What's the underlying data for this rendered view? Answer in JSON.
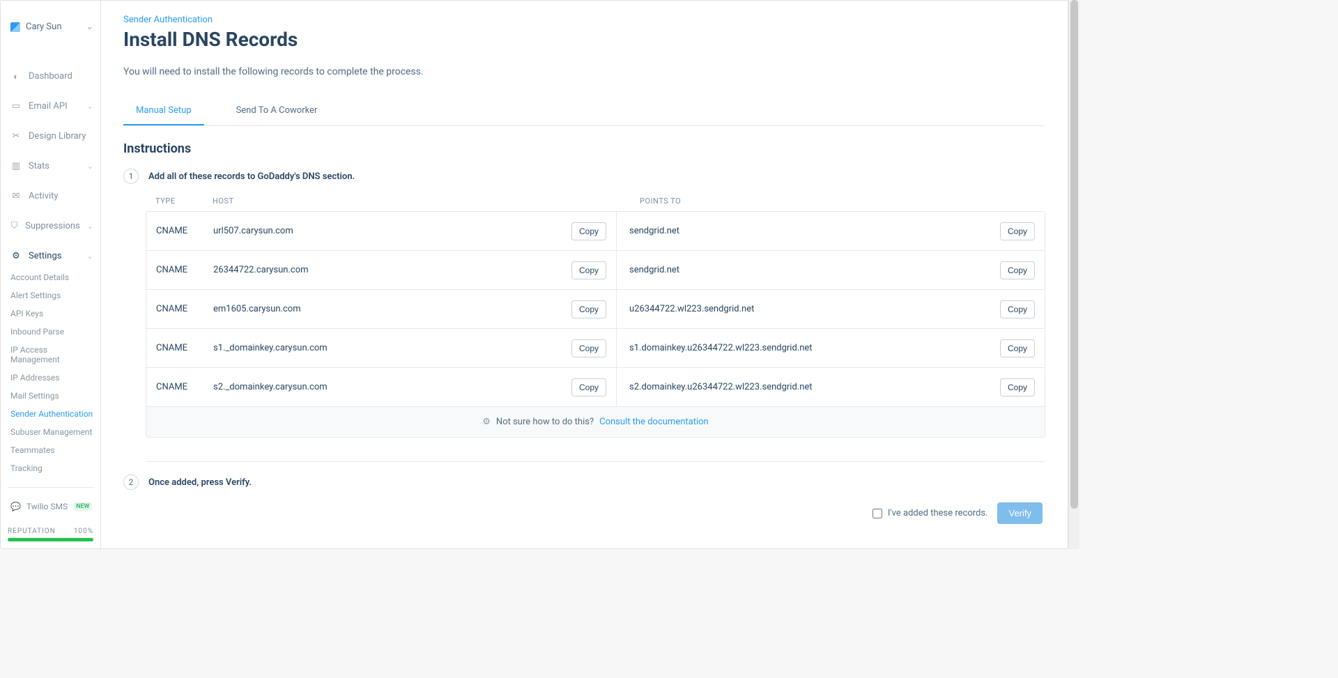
{
  "account": {
    "name": "Cary Sun"
  },
  "sidebar": {
    "items": [
      {
        "label": "Dashboard",
        "icon": "gauge"
      },
      {
        "label": "Email API",
        "icon": "card",
        "caret": true
      },
      {
        "label": "Design Library",
        "icon": "scissors"
      },
      {
        "label": "Stats",
        "icon": "bars",
        "caret": true
      },
      {
        "label": "Activity",
        "icon": "envelope"
      },
      {
        "label": "Suppressions",
        "icon": "shield",
        "caret": true
      },
      {
        "label": "Settings",
        "icon": "sliders",
        "caret": true,
        "active": true
      }
    ],
    "subnav": [
      {
        "label": "Account Details"
      },
      {
        "label": "Alert Settings"
      },
      {
        "label": "API Keys"
      },
      {
        "label": "Inbound Parse"
      },
      {
        "label": "IP Access Management"
      },
      {
        "label": "IP Addresses"
      },
      {
        "label": "Mail Settings"
      },
      {
        "label": "Sender Authentication",
        "active": true
      },
      {
        "label": "Subuser Management"
      },
      {
        "label": "Teammates"
      },
      {
        "label": "Tracking"
      }
    ],
    "twilio": {
      "label": "Twilio SMS",
      "badge": "NEW"
    },
    "reputation": {
      "label": "REPUTATION",
      "value": "100%"
    }
  },
  "page": {
    "breadcrumb": "Sender Authentication",
    "title": "Install DNS Records",
    "subtitle": "You will need to install the following records to complete the process.",
    "tabs": [
      {
        "label": "Manual Setup",
        "active": true
      },
      {
        "label": "Send To A Coworker"
      }
    ],
    "instructions_heading": "Instructions",
    "step1": "Add all of these records to GoDaddy's DNS section.",
    "step2": "Once added, press Verify.",
    "table": {
      "headers": {
        "type": "TYPE",
        "host": "HOST",
        "points": "POINTS TO"
      },
      "copy_label": "Copy",
      "rows": [
        {
          "type": "CNAME",
          "host": "url507.carysun.com",
          "points": "sendgrid.net"
        },
        {
          "type": "CNAME",
          "host": "26344722.carysun.com",
          "points": "sendgrid.net"
        },
        {
          "type": "CNAME",
          "host": "em1605.carysun.com",
          "points": "u26344722.wl223.sendgrid.net"
        },
        {
          "type": "CNAME",
          "host": "s1._domainkey.carysun.com",
          "points": "s1.domainkey.u26344722.wl223.sendgrid.net"
        },
        {
          "type": "CNAME",
          "host": "s2._domainkey.carysun.com",
          "points": "s2.domainkey.u26344722.wl223.sendgrid.net"
        }
      ],
      "help_text": "Not sure how to do this?",
      "help_link": "Consult the documentation"
    },
    "verify": {
      "checkbox_label": "I've added these records.",
      "button": "Verify"
    }
  }
}
